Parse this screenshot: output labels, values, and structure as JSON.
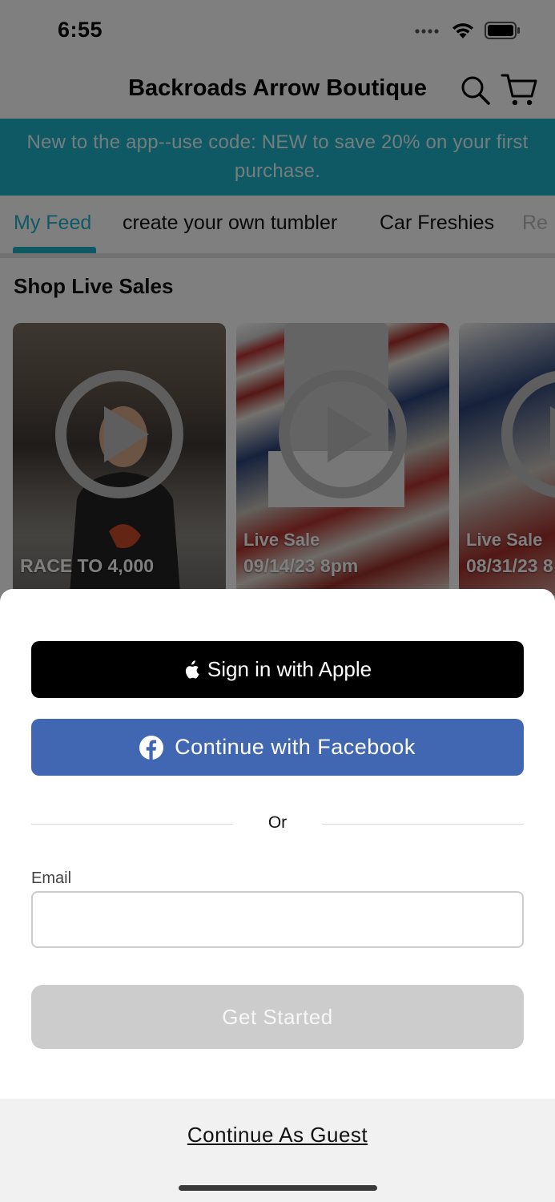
{
  "status_bar": {
    "time": "6:55"
  },
  "header": {
    "title": "Backroads Arrow Boutique"
  },
  "promo": {
    "text": "New to the app--use code: NEW to save 20% on your first purchase."
  },
  "tabs": [
    {
      "label": "My Feed",
      "active": true
    },
    {
      "label": "create your own tumbler"
    },
    {
      "label": "Car Freshies"
    },
    {
      "label": "Re"
    }
  ],
  "section": {
    "title": "Shop Live Sales"
  },
  "cards": [
    {
      "label": "",
      "title": "RACE TO 4,000"
    },
    {
      "label": "Live Sale",
      "title": "09/14/23 8pm"
    },
    {
      "label": "Live Sale",
      "title": "08/31/23 8"
    }
  ],
  "sheet": {
    "apple_label": "Sign in with Apple",
    "facebook_label": "Continue with Facebook",
    "or_text": "Or",
    "email_label": "Email",
    "email_value": "",
    "email_placeholder": "",
    "get_started_label": "Get Started",
    "guest_label": "Continue As Guest"
  },
  "colors": {
    "accent": "#1fb2c9",
    "facebook": "#4267b2",
    "apple": "#000000",
    "disabled_button": "#cccccc"
  }
}
